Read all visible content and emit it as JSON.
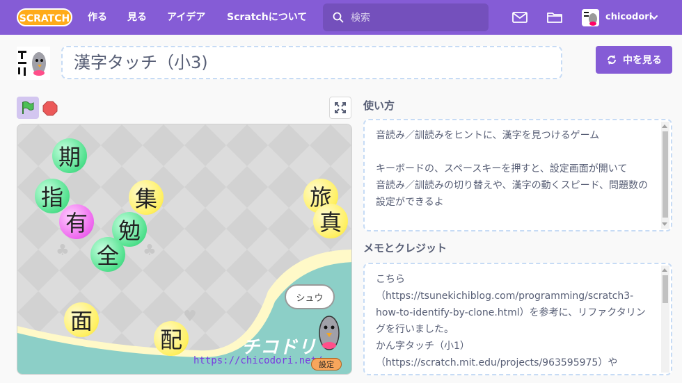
{
  "nav": {
    "logo": "SCRATCH",
    "items": [
      "作る",
      "見る",
      "アイデア",
      "Scratchについて"
    ],
    "search_placeholder": "検索",
    "username": "chicodori"
  },
  "project": {
    "title": "漢字タッチ（小3)",
    "see_inside": "中を見る"
  },
  "stage": {
    "kanji": [
      {
        "char": "期",
        "color": "green"
      },
      {
        "char": "指",
        "color": "green"
      },
      {
        "char": "有",
        "color": "pink"
      },
      {
        "char": "集",
        "color": "yellow"
      },
      {
        "char": "勉",
        "color": "green"
      },
      {
        "char": "全",
        "color": "green"
      },
      {
        "char": "旅",
        "color": "yellow"
      },
      {
        "char": "真",
        "color": "yellow"
      },
      {
        "char": "面",
        "color": "yellow"
      },
      {
        "char": "配",
        "color": "yellow"
      }
    ],
    "bubble": "シュウ",
    "brand": "チコドリ",
    "url": "https://chicodori.net/",
    "settings": "設定"
  },
  "instructions": {
    "label": "使い方",
    "text": "音読み／訓読みをヒントに、漢字を見つけるゲーム\n\nキーボードの、スペースキーを押すと、設定画面が開いて\n音読み／訓読みの切り替えや、漢字の動くスピード、問題数の設定ができるよ"
  },
  "credits": {
    "label": "メモとクレジット",
    "text": "こちら\n（https://tsunekichiblog.com/programming/scratch3-how-to-identify-by-clone.html）を参考に、リファクタリングを行いました。\nかん字タッチ（小1）\n（https://scratch.mit.edu/projects/963595975）や"
  },
  "colors": {
    "brand": "#855cd6",
    "green_ball": "#4fe08c",
    "yellow_ball": "#fff060",
    "pink_ball": "#ee66ee",
    "teal_ground": "#8ccfc7"
  }
}
